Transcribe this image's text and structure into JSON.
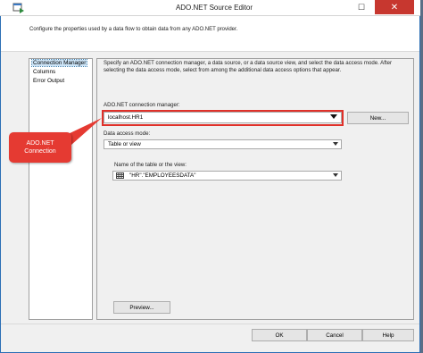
{
  "window": {
    "title": "ADO.NET Source Editor",
    "maximize_glyph": "☐",
    "close_glyph": "✕"
  },
  "header": {
    "description": "Configure the properties used by a data flow to obtain data from any ADO.NET provider."
  },
  "nav": {
    "items": [
      "Connection Manager",
      "Columns",
      "Error Output"
    ],
    "selected_index": 0
  },
  "main": {
    "intro": "Specify an ADO.NET connection manager, a data source, or a data source view, and select the data access mode. After selecting the data access mode, select from among the additional data access options that appear.",
    "connection_manager_label": "ADO.NET connection manager:",
    "connection_manager_value": "localhost.HR1",
    "new_button": "New...",
    "data_access_mode_label": "Data access mode:",
    "data_access_mode_value": "Table or view",
    "table_label": "Name of the table or the view:",
    "table_value": "\"HR\".\"EMPLOYEESDATA\"",
    "preview_button": "Preview..."
  },
  "callout": {
    "line1": "ADO.NET",
    "line2": "Connection",
    "color": "#e53a32"
  },
  "footer": {
    "ok": "OK",
    "cancel": "Cancel",
    "help": "Help"
  },
  "icons": {
    "app": "ado-source-icon",
    "table": "table-grid-icon",
    "dropdown": "chevron-down-icon"
  },
  "colors": {
    "accent": "#2c6fb5",
    "highlight": "#e0312a",
    "selection": "#cce4f7",
    "close_button": "#c7372f"
  }
}
